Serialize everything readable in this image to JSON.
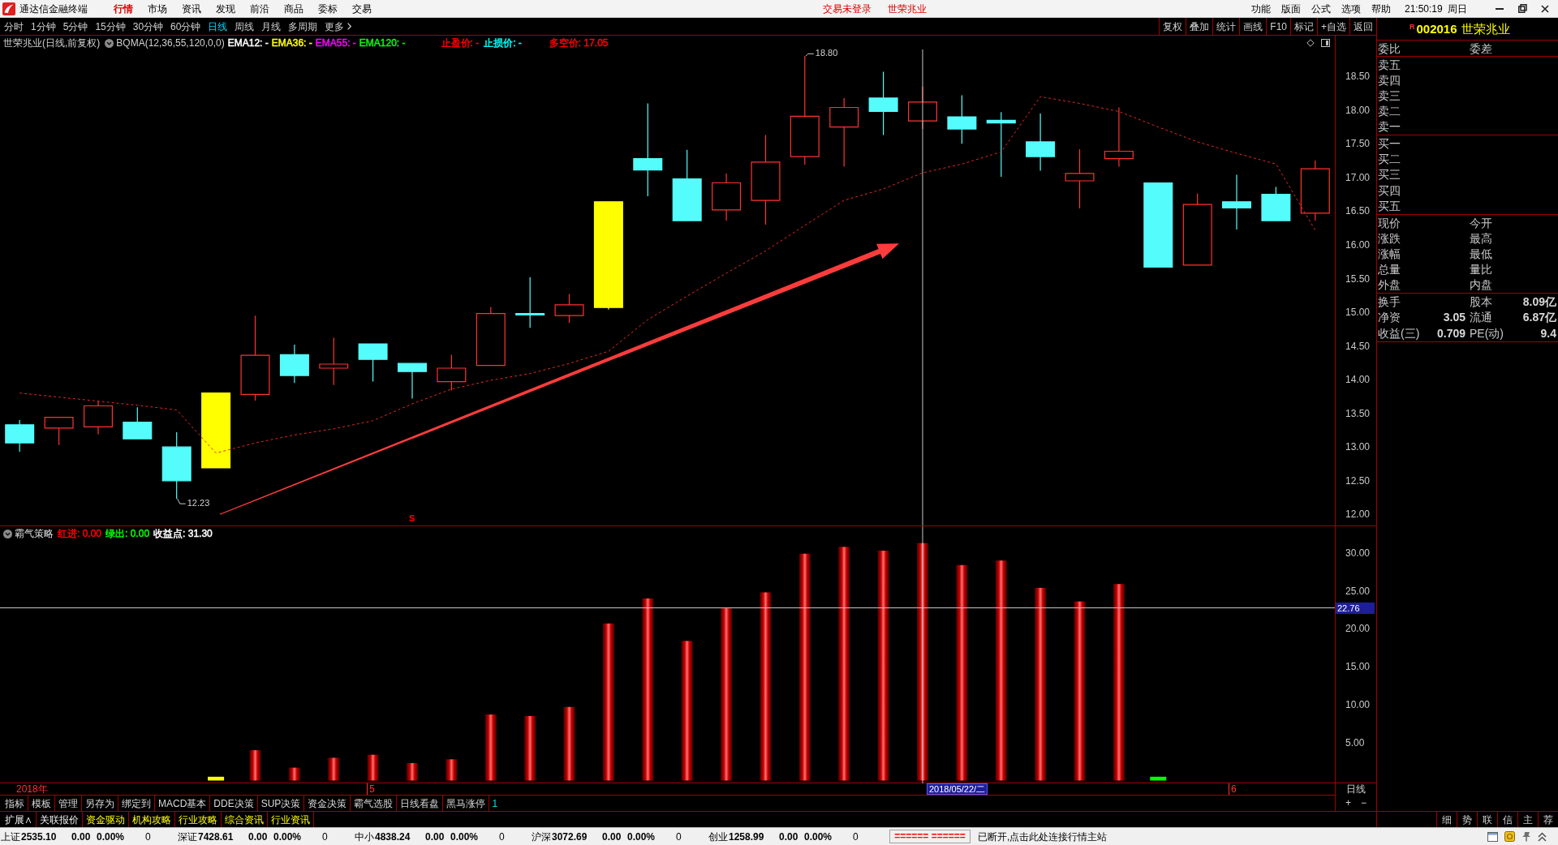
{
  "title_bar": {
    "app_name": "通达信金融终端",
    "menu": [
      {
        "label": "行情",
        "selected": true
      },
      {
        "label": "市场",
        "selected": false
      },
      {
        "label": "资讯",
        "selected": false
      },
      {
        "label": "发现",
        "selected": false
      },
      {
        "label": "前沿",
        "selected": false
      },
      {
        "label": "商品",
        "selected": false
      },
      {
        "label": "委标",
        "selected": false
      },
      {
        "label": "交易",
        "selected": false
      }
    ],
    "notices": [
      "交易未登录",
      "世荣兆业"
    ],
    "right_menu": [
      "功能",
      "版面",
      "公式",
      "选项",
      "帮助"
    ],
    "time": "21:50:19",
    "weekday": "周日"
  },
  "period_bar": {
    "periods": [
      {
        "label": "分时",
        "selected": false
      },
      {
        "label": "1分钟",
        "selected": false
      },
      {
        "label": "5分钟",
        "selected": false
      },
      {
        "label": "15分钟",
        "selected": false
      },
      {
        "label": "30分钟",
        "selected": false
      },
      {
        "label": "60分钟",
        "selected": false
      },
      {
        "label": "日线",
        "selected": true
      },
      {
        "label": "周线",
        "selected": false
      },
      {
        "label": "月线",
        "selected": false
      },
      {
        "label": "多周期",
        "selected": false
      }
    ],
    "more": "更多",
    "tools": [
      "复权",
      "叠加",
      "统计",
      "画线",
      "F10",
      "标记",
      "+自选",
      "返回"
    ]
  },
  "price_panel": {
    "title": "世荣兆业(日线,前复权)",
    "formula": "BQMA(12,36,55,120,0,0)",
    "legend": [
      {
        "text": "EMA12: -",
        "color": "#ffffff"
      },
      {
        "text": "EMA36: -",
        "color": "#ffff00"
      },
      {
        "text": "EMA55: -",
        "color": "#ff00ff"
      },
      {
        "text": "EMA120: -",
        "color": "#00ff00"
      },
      {
        "text": "止盈价: -",
        "color": "#ff0000"
      },
      {
        "text": "止损价: -",
        "color": "#00ffff"
      },
      {
        "text": "多空价: 17.05",
        "color": "#ff0000"
      }
    ],
    "marker_letter": "S",
    "chart_data": {
      "type": "line",
      "ylim": [
        11.835,
        19.105
      ],
      "yticks": [
        {
          "value": 18.5,
          "label": "18.50"
        },
        {
          "value": 18.0,
          "label": "18.00"
        },
        {
          "value": 17.5,
          "label": "17.50"
        },
        {
          "value": 17.0,
          "label": "17.00"
        },
        {
          "value": 16.5,
          "label": "16.50"
        },
        {
          "value": 16.0,
          "label": "16.00"
        },
        {
          "value": 15.5,
          "label": "15.50"
        },
        {
          "value": 15.0,
          "label": "15.00"
        },
        {
          "value": 14.5,
          "label": "14.50"
        },
        {
          "value": 14.0,
          "label": "14.00"
        },
        {
          "value": 13.5,
          "label": "13.50"
        },
        {
          "value": 13.0,
          "label": "13.00"
        },
        {
          "value": 12.5,
          "label": "12.50"
        },
        {
          "value": 12.0,
          "label": "12.00"
        }
      ],
      "series": [
        {
          "color": "#e02828",
          "line_style": "dashed",
          "values": [
            13.8,
            13.74,
            13.68,
            13.62,
            13.55,
            12.91,
            13.06,
            13.18,
            13.27,
            13.39,
            13.64,
            13.86,
            13.99,
            14.09,
            14.24,
            14.42,
            14.89,
            15.24,
            15.58,
            15.91,
            16.29,
            16.66,
            16.83,
            17.07,
            17.2,
            17.38,
            18.2,
            18.1,
            17.98,
            17.75,
            17.53,
            17.36,
            17.2,
            16.22
          ]
        }
      ],
      "annotations": [
        "18.80",
        "12.23"
      ]
    }
  },
  "indicator_panel": {
    "name": "霸气策略",
    "legend": [
      {
        "text": "红进: 0.00",
        "color": "#ff0000"
      },
      {
        "text": "绿出: 0.00",
        "color": "#00ff00"
      },
      {
        "text": "收益点: 31.30",
        "color": "#ffffff"
      }
    ],
    "chart_data": {
      "type": "bar",
      "ylim": [
        -0.374,
        33.51
      ],
      "yticks": [
        {
          "value": 30,
          "label": "30.00"
        },
        {
          "value": 25,
          "label": "25.00"
        },
        {
          "value": 20,
          "label": "20.00"
        },
        {
          "value": 15,
          "label": "15.00"
        },
        {
          "value": 10,
          "label": "10.00"
        },
        {
          "value": 5,
          "label": "5.00"
        }
      ],
      "series": [
        {
          "values": [
            null,
            null,
            null,
            null,
            null,
            null,
            4.0,
            1.7,
            3.0,
            3.4,
            2.3,
            2.8,
            8.7,
            8.5,
            9.7,
            20.7,
            24.0,
            18.4,
            22.7,
            24.8,
            29.9,
            30.8,
            30.3,
            31.3,
            28.4,
            29.0,
            25.4,
            23.6,
            25.9,
            null,
            null,
            null,
            null,
            null
          ]
        },
        {
          "color": "#ffff00",
          "values": [
            null,
            null,
            null,
            null,
            null,
            0.5,
            null,
            null,
            null,
            null,
            null,
            null,
            null,
            null,
            null,
            null,
            null,
            null,
            null,
            null,
            null,
            null,
            null,
            null,
            null,
            null,
            null,
            null,
            null,
            null,
            null,
            null,
            null,
            null
          ]
        },
        {
          "color": "#00ff00",
          "values": [
            null,
            null,
            null,
            null,
            null,
            null,
            null,
            null,
            null,
            null,
            null,
            null,
            null,
            null,
            null,
            null,
            null,
            null,
            null,
            null,
            null,
            null,
            null,
            null,
            null,
            null,
            null,
            null,
            null,
            0.5,
            null,
            null,
            null,
            null
          ]
        }
      ],
      "ref_lines": [
        {
          "axis": "y",
          "value": 22.76,
          "label": "22.76"
        }
      ]
    }
  },
  "date_axis": {
    "labels": [
      "2018年",
      "5",
      "6"
    ],
    "cursor_date": "2018/05/22/二",
    "period": "日线",
    "zoom_in": "+",
    "zoom_out": "−"
  },
  "toolbar_1": {
    "items": [
      "指标",
      "模板",
      "管理",
      "另存为",
      "绑定到",
      "MACD基本",
      "DDE决策",
      "SUP决策",
      "资金决策",
      "霸气选股",
      "日线看盘",
      "黑马涨停"
    ],
    "page": "1"
  },
  "toolbar_2": {
    "items": [
      {
        "label": "扩展∧",
        "highlighted": false
      },
      {
        "label": "关联报价",
        "highlighted": false
      },
      {
        "label": "资金驱动",
        "highlighted": true
      },
      {
        "label": "机构攻略",
        "highlighted": true
      },
      {
        "label": "行业攻略",
        "highlighted": true
      },
      {
        "label": "综合资讯",
        "highlighted": true
      },
      {
        "label": "行业资讯",
        "highlighted": true
      }
    ]
  },
  "quote_panel": {
    "badge": "R",
    "code": "002016",
    "name": "世荣兆业",
    "ratio_row": [
      "委比",
      "委差"
    ],
    "asks": [
      "卖五",
      "卖四",
      "卖三",
      "卖二",
      "卖一"
    ],
    "bids": [
      "买一",
      "买二",
      "买三",
      "买四",
      "买五"
    ],
    "quote_rows": [
      {
        "left": "现价",
        "right": "今开"
      },
      {
        "left": "涨跌",
        "right": "最高"
      },
      {
        "left": "涨幅",
        "right": "最低"
      },
      {
        "left": "总量",
        "right": "量比"
      },
      {
        "left": "外盘",
        "right": "内盘"
      }
    ],
    "fundamentals": [
      {
        "left": "换手",
        "right": "股本",
        "right_value": "8.09亿"
      },
      {
        "left": "净资",
        "left_value": "3.05",
        "right": "流通",
        "right_value": "6.87亿"
      },
      {
        "left": "收益(三)",
        "left_value": "0.709",
        "right": "PE(动)",
        "right_value": "9.4"
      }
    ],
    "tabs": [
      "细",
      "势",
      "联",
      "信",
      "主",
      "荐"
    ]
  },
  "status_bar": {
    "indices": [
      {
        "name": "上证",
        "value": "2535.10",
        "change": "0.00",
        "percent": "0.00%",
        "volume": "0"
      },
      {
        "name": "深证",
        "value": "7428.61",
        "change": "0.00",
        "percent": "0.00%",
        "volume": "0"
      },
      {
        "name": "中小",
        "value": "4838.24",
        "change": "0.00",
        "percent": "0.00%",
        "volume": "0"
      },
      {
        "name": "沪深",
        "value": "3072.69",
        "change": "0.00",
        "percent": "0.00%",
        "volume": "0"
      },
      {
        "name": "创业",
        "value": "1258.99",
        "change": "0.00",
        "percent": "0.00%",
        "volume": "0"
      }
    ],
    "link_status": "====== ======",
    "message": "已断开,点击此处连接行情主站"
  }
}
